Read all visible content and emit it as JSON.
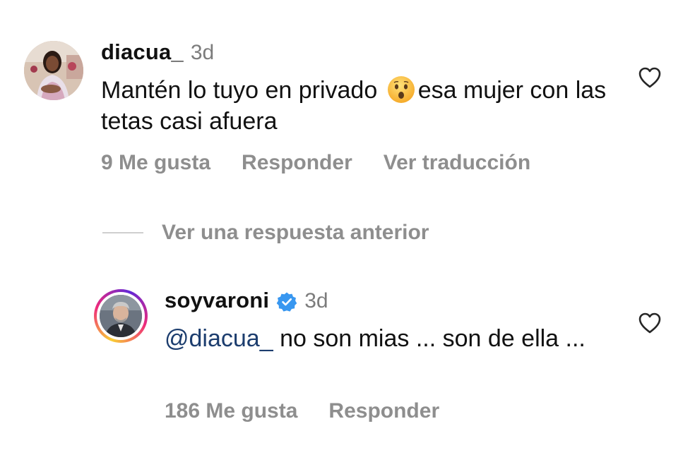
{
  "comments": [
    {
      "username": "diacua_",
      "time": "3d",
      "text_part1": "Mantén lo tuyo en privado",
      "emoji": "hushed-face-emoji",
      "text_part2": "esa mujer con las tetas casi afuera",
      "likes_label": "9 Me gusta",
      "reply_label": "Responder",
      "translate_label": "Ver traducción",
      "like_icon": "heart-outline-icon"
    }
  ],
  "view_replies": {
    "label": "Ver una respuesta anterior"
  },
  "reply": {
    "username": "soyvaroni",
    "verified_icon": "verified-badge-icon",
    "time": "3d",
    "mention": "@diacua_",
    "text": "no son mias ... son de ella ...",
    "likes_label": "186 Me gusta",
    "reply_label": "Responder",
    "like_icon": "heart-outline-icon",
    "story_ring_colors": [
      "#f9ce34",
      "#ee2a7b",
      "#6228d7"
    ]
  },
  "colors": {
    "text": "#111111",
    "muted": "#8e8e8e",
    "mention": "#1c3d6e",
    "verified": "#3897f0"
  }
}
